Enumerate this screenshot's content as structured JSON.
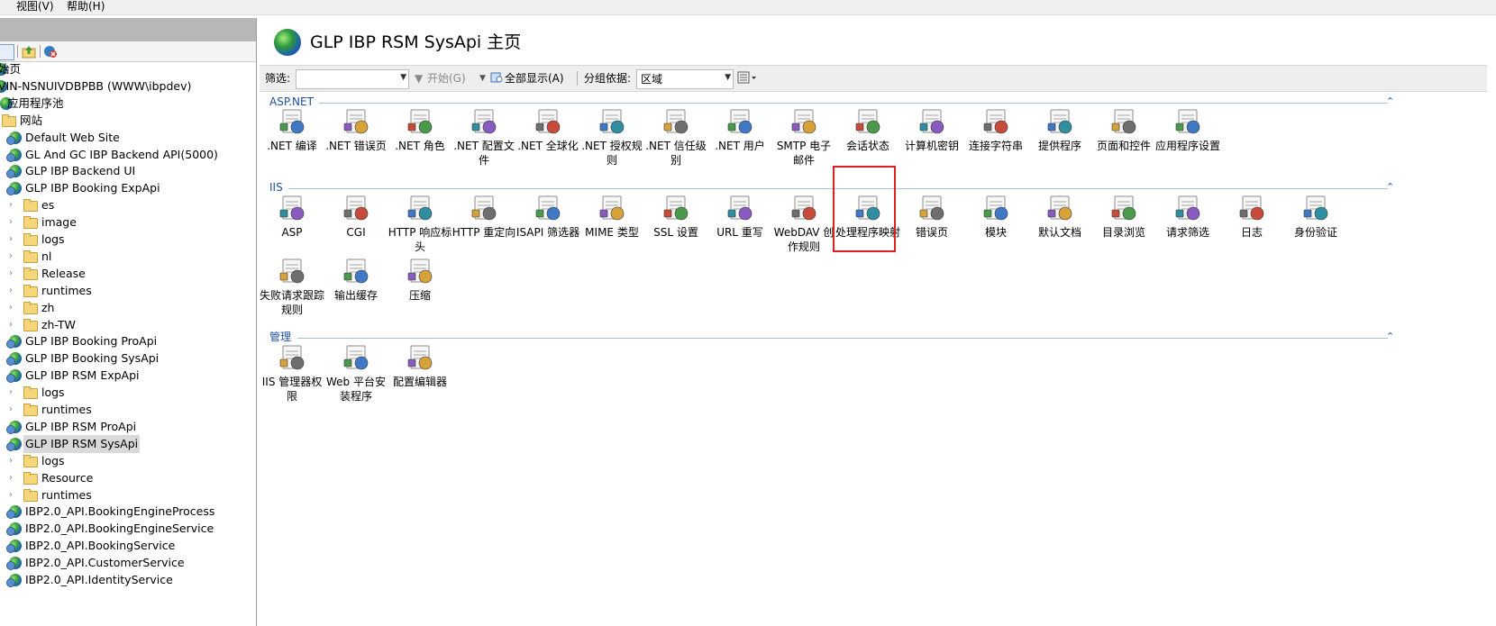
{
  "menubar": {
    "items": [
      "视图(V)",
      "帮助(H)"
    ]
  },
  "tree": {
    "items": [
      {
        "label": "始页",
        "level": 0,
        "icon": "start-page-icon"
      },
      {
        "label": "VIN-NSNUIVDBPBB (WWW\\ibpdev)",
        "level": 0,
        "icon": "server-icon"
      },
      {
        "label": "应用程序池",
        "level": 1,
        "icon": "app-pool-icon"
      },
      {
        "label": "网站",
        "level": 0,
        "icon": "folder-icon"
      },
      {
        "label": "Default Web Site",
        "level": 1,
        "icon": "globe-icon"
      },
      {
        "label": "GL And GC IBP Backend API(5000)",
        "level": 1,
        "icon": "globe-icon"
      },
      {
        "label": "GLP IBP Backend UI",
        "level": 1,
        "icon": "globe-icon"
      },
      {
        "label": "GLP IBP Booking ExpApi",
        "level": 1,
        "icon": "globe-icon"
      },
      {
        "label": "es",
        "level": 2,
        "icon": "folder-icon"
      },
      {
        "label": "image",
        "level": 2,
        "icon": "folder-icon"
      },
      {
        "label": "logs",
        "level": 2,
        "icon": "folder-icon"
      },
      {
        "label": "nl",
        "level": 2,
        "icon": "folder-icon"
      },
      {
        "label": "Release",
        "level": 2,
        "icon": "folder-icon"
      },
      {
        "label": "runtimes",
        "level": 2,
        "icon": "folder-icon"
      },
      {
        "label": "zh",
        "level": 2,
        "icon": "folder-icon"
      },
      {
        "label": "zh-TW",
        "level": 2,
        "icon": "folder-icon"
      },
      {
        "label": "GLP IBP Booking ProApi",
        "level": 1,
        "icon": "globe-icon"
      },
      {
        "label": "GLP IBP Booking SysApi",
        "level": 1,
        "icon": "globe-icon"
      },
      {
        "label": "GLP IBP RSM ExpApi",
        "level": 1,
        "icon": "globe-icon"
      },
      {
        "label": "logs",
        "level": 2,
        "icon": "folder-icon"
      },
      {
        "label": "runtimes",
        "level": 2,
        "icon": "folder-icon"
      },
      {
        "label": "GLP IBP RSM ProApi",
        "level": 1,
        "icon": "globe-icon"
      },
      {
        "label": "GLP IBP RSM SysApi",
        "level": 1,
        "icon": "globe-icon",
        "selected": true
      },
      {
        "label": "logs",
        "level": 2,
        "icon": "folder-icon"
      },
      {
        "label": "Resource",
        "level": 2,
        "icon": "folder-icon"
      },
      {
        "label": "runtimes",
        "level": 2,
        "icon": "folder-icon"
      },
      {
        "label": "IBP2.0_API.BookingEngineProcess",
        "level": 1,
        "icon": "globe-icon"
      },
      {
        "label": "IBP2.0_API.BookingEngineService",
        "level": 1,
        "icon": "globe-icon"
      },
      {
        "label": "IBP2.0_API.BookingService",
        "level": 1,
        "icon": "globe-icon"
      },
      {
        "label": "IBP2.0_API.CustomerService",
        "level": 1,
        "icon": "globe-icon"
      },
      {
        "label": "IBP2.0_API.IdentityService",
        "level": 1,
        "icon": "globe-icon"
      }
    ]
  },
  "main": {
    "title": "GLP IBP RSM SysApi 主页",
    "filter": {
      "label": "筛选:",
      "value": "",
      "start_label": "开始(G)",
      "show_all_label": "全部显示(A)",
      "group_label": "分组依据:",
      "group_value": "区域"
    },
    "sections": [
      {
        "title": "ASP.NET",
        "features": [
          {
            "label": ".NET 编译",
            "icon": "compile-icon"
          },
          {
            "label": ".NET 错误页",
            "icon": "error-page-404-icon"
          },
          {
            "label": ".NET 角色",
            "icon": "roles-icon"
          },
          {
            "label": ".NET 配置文件",
            "icon": "profile-icon"
          },
          {
            "label": ".NET 全球化",
            "icon": "globalization-icon"
          },
          {
            "label": ".NET 授权规则",
            "icon": "authorization-rules-icon"
          },
          {
            "label": ".NET 信任级别",
            "icon": "trust-levels-icon"
          },
          {
            "label": ".NET 用户",
            "icon": "users-icon"
          },
          {
            "label": "SMTP 电子邮件",
            "icon": "smtp-email-icon"
          },
          {
            "label": "会话状态",
            "icon": "session-state-icon"
          },
          {
            "label": "计算机密钥",
            "icon": "machine-key-icon"
          },
          {
            "label": "连接字符串",
            "icon": "connection-strings-icon"
          },
          {
            "label": "提供程序",
            "icon": "providers-icon"
          },
          {
            "label": "页面和控件",
            "icon": "pages-controls-icon"
          },
          {
            "label": "应用程序设置",
            "icon": "app-settings-icon"
          }
        ]
      },
      {
        "title": "IIS",
        "features": [
          {
            "label": "ASP",
            "icon": "asp-icon"
          },
          {
            "label": "CGI",
            "icon": "cgi-icon"
          },
          {
            "label": "HTTP 响应标头",
            "icon": "http-response-headers-icon"
          },
          {
            "label": "HTTP 重定向",
            "icon": "http-redirect-icon"
          },
          {
            "label": "ISAPI 筛选器",
            "icon": "isapi-filters-icon"
          },
          {
            "label": "MIME 类型",
            "icon": "mime-types-icon"
          },
          {
            "label": "SSL 设置",
            "icon": "ssl-lock-icon"
          },
          {
            "label": "URL 重写",
            "icon": "url-rewrite-icon"
          },
          {
            "label": "WebDAV 创作规则",
            "icon": "webdav-icon"
          },
          {
            "label": "处理程序映射",
            "icon": "handler-mappings-icon"
          },
          {
            "label": "错误页",
            "icon": "error-pages-icon"
          },
          {
            "label": "模块",
            "icon": "modules-icon"
          },
          {
            "label": "默认文档",
            "icon": "default-document-icon"
          },
          {
            "label": "目录浏览",
            "icon": "directory-browsing-icon"
          },
          {
            "label": "请求筛选",
            "icon": "request-filtering-icon"
          },
          {
            "label": "日志",
            "icon": "logging-icon"
          },
          {
            "label": "身份验证",
            "icon": "authentication-icon"
          },
          {
            "label": "失败请求跟踪规则",
            "icon": "failed-request-tracing-icon"
          },
          {
            "label": "输出缓存",
            "icon": "output-caching-icon"
          },
          {
            "label": "压缩",
            "icon": "compression-icon"
          }
        ]
      },
      {
        "title": "管理",
        "features": [
          {
            "label": "IIS 管理器权限",
            "icon": "iis-manager-permissions-icon"
          },
          {
            "label": "Web 平台安装程序",
            "icon": "web-platform-installer-icon"
          },
          {
            "label": "配置编辑器",
            "icon": "configuration-editor-icon"
          }
        ]
      }
    ]
  },
  "colors": {
    "section_title": "#1f4e9c",
    "highlight": "#e02020",
    "selected_bg": "#d9d9d9"
  }
}
